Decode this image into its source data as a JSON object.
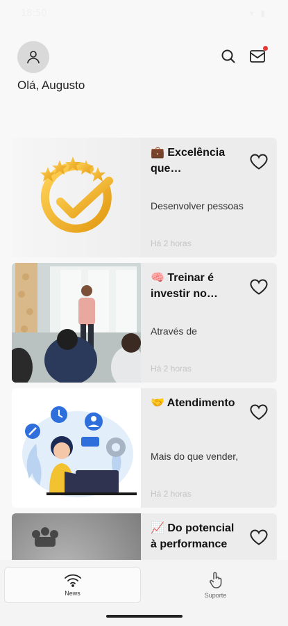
{
  "status_bar": {
    "time": "18:50",
    "icons": "▾ ▮"
  },
  "header": {
    "greeting": "Olá, Augusto",
    "avatar_icon": "person-icon",
    "search_icon": "search-icon",
    "mail_icon": "mail-icon",
    "has_notification": true
  },
  "feed": {
    "cards": [
      {
        "title": "💼 Excelência que transformam",
        "description": "Desenvolver pessoas",
        "time": "Há 2 horas",
        "image": "gold-checkmark-stars"
      },
      {
        "title": "🧠 Treinar é investir no futuro",
        "description": "Através de",
        "time": "Há 2 horas",
        "image": "training-presentation"
      },
      {
        "title": "🤝 Atendimento",
        "description": "Mais do que vender,",
        "time": "Há 2 horas",
        "image": "customer-support-illustration"
      },
      {
        "title": "📈 Do potencial à performance",
        "description": "",
        "time": "",
        "image": "chess-piece-grayscale"
      }
    ]
  },
  "nav": {
    "news_label": "News",
    "support_label": "Suporte"
  },
  "colors": {
    "background": "#f8f8f8",
    "card": "#ececec",
    "accent_red": "#e53935",
    "gold": "#f2b320"
  }
}
